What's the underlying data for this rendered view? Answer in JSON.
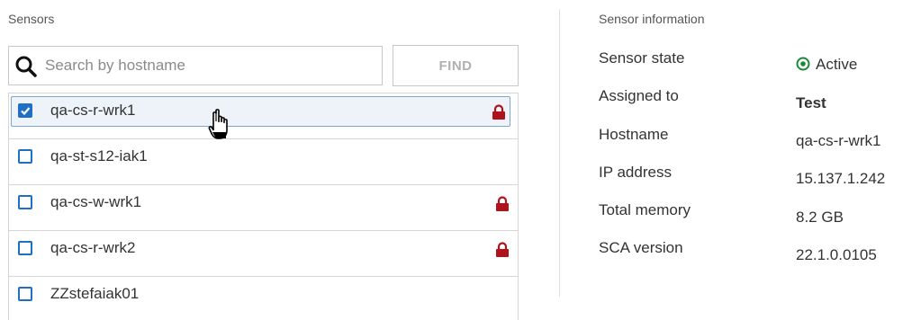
{
  "sensors_panel": {
    "title": "Sensors",
    "search": {
      "placeholder": "Search by hostname",
      "value": ""
    },
    "find_label": "FIND",
    "items": [
      {
        "hostname": "qa-cs-r-wrk1",
        "checked": true,
        "locked": true
      },
      {
        "hostname": "qa-st-s12-iak1",
        "checked": false,
        "locked": false
      },
      {
        "hostname": "qa-cs-w-wrk1",
        "checked": false,
        "locked": true
      },
      {
        "hostname": "qa-cs-r-wrk2",
        "checked": false,
        "locked": true
      },
      {
        "hostname": "ZZstefaiak01",
        "checked": false,
        "locked": false
      }
    ]
  },
  "sensor_info": {
    "title": "Sensor information",
    "rows": [
      {
        "label": "Sensor state",
        "value": "Active"
      },
      {
        "label": "Assigned to",
        "value": "Test"
      },
      {
        "label": "Hostname",
        "value": "qa-cs-r-wrk1"
      },
      {
        "label": "IP address",
        "value": "15.137.1.242"
      },
      {
        "label": "Total memory",
        "value": "8.2 GB"
      },
      {
        "label": "SCA version",
        "value": "22.1.0.0105"
      }
    ]
  },
  "colors": {
    "checkbox_blue": "#1f6fc5",
    "lock_red": "#b0121b",
    "active_green": "#1a8a3a",
    "selection_border": "#7aa7d6"
  },
  "icons": {
    "search": "search-icon",
    "lock": "lock-icon",
    "active": "active-status-icon",
    "cursor": "hand-pointer-cursor-icon"
  }
}
